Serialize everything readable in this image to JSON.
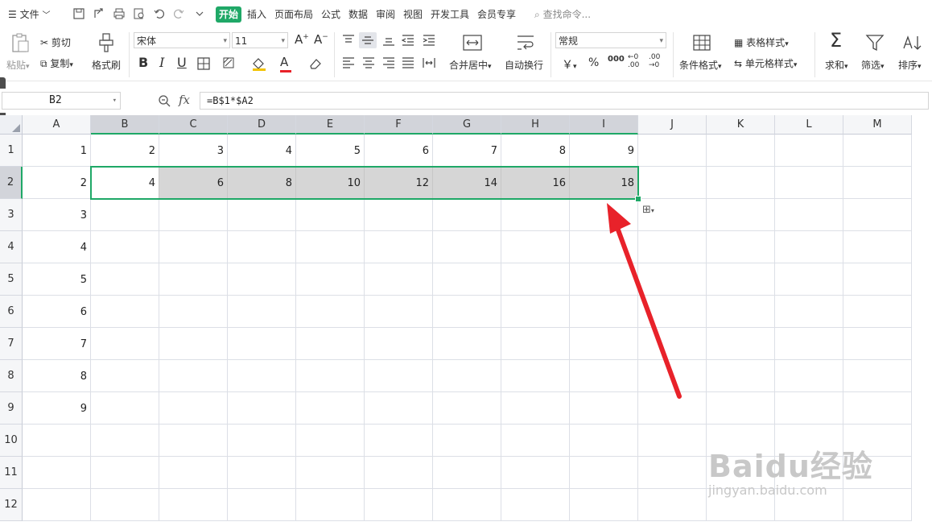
{
  "menubar": {
    "file_menu": "文件",
    "tabs": [
      "开始",
      "插入",
      "页面布局",
      "公式",
      "数据",
      "审阅",
      "视图",
      "开发工具",
      "会员专享"
    ],
    "active_tab": "开始",
    "search_placeholder": "查找命令..."
  },
  "ribbon": {
    "paste": "粘贴",
    "cut": "剪切",
    "copy": "复制",
    "format_painter": "格式刷",
    "font_name": "宋体",
    "font_size": "11",
    "bold": "B",
    "italic": "I",
    "underline": "U",
    "merge_center": "合并居中",
    "wrap_text": "自动换行",
    "number_format": "常规",
    "currency": "￥",
    "percent": "%",
    "thousands": "000",
    "cond_format": "条件格式",
    "table_style": "表格样式",
    "cell_style": "单元格样式",
    "sum": "求和",
    "filter": "筛选",
    "sort": "排序"
  },
  "formula_bar": {
    "cell_ref": "B2",
    "fx": "fx",
    "formula": "=B$1*$A2"
  },
  "sheet": {
    "columns": [
      "A",
      "B",
      "C",
      "D",
      "E",
      "F",
      "G",
      "H",
      "I",
      "J",
      "K",
      "L",
      "M"
    ],
    "rows": [
      "1",
      "2",
      "3",
      "4",
      "5",
      "6",
      "7",
      "8",
      "9",
      "10",
      "11",
      "12"
    ],
    "cells": [
      [
        "1",
        "2",
        "3",
        "4",
        "5",
        "6",
        "7",
        "8",
        "9",
        "",
        "",
        "",
        ""
      ],
      [
        "2",
        "4",
        "6",
        "8",
        "10",
        "12",
        "14",
        "16",
        "18",
        "",
        "",
        "",
        ""
      ],
      [
        "3",
        "",
        "",
        "",
        "",
        "",
        "",
        "",
        "",
        "",
        "",
        "",
        ""
      ],
      [
        "4",
        "",
        "",
        "",
        "",
        "",
        "",
        "",
        "",
        "",
        "",
        "",
        ""
      ],
      [
        "5",
        "",
        "",
        "",
        "",
        "",
        "",
        "",
        "",
        "",
        "",
        "",
        ""
      ],
      [
        "6",
        "",
        "",
        "",
        "",
        "",
        "",
        "",
        "",
        "",
        "",
        "",
        ""
      ],
      [
        "7",
        "",
        "",
        "",
        "",
        "",
        "",
        "",
        "",
        "",
        "",
        "",
        ""
      ],
      [
        "8",
        "",
        "",
        "",
        "",
        "",
        "",
        "",
        "",
        "",
        "",
        "",
        ""
      ],
      [
        "9",
        "",
        "",
        "",
        "",
        "",
        "",
        "",
        "",
        "",
        "",
        "",
        ""
      ],
      [
        "",
        "",
        "",
        "",
        "",
        "",
        "",
        "",
        "",
        "",
        "",
        "",
        ""
      ],
      [
        "",
        "",
        "",
        "",
        "",
        "",
        "",
        "",
        "",
        "",
        "",
        "",
        ""
      ],
      [
        "",
        "",
        "",
        "",
        "",
        "",
        "",
        "",
        "",
        "",
        "",
        "",
        ""
      ]
    ],
    "selection": "B2:I2"
  },
  "watermark": {
    "main": "Baidu经验",
    "sub": "jingyan.baidu.com"
  },
  "colors": {
    "accent": "#1fa867",
    "arrow": "#e8222a",
    "selection_fill": "#d6d6d6"
  }
}
